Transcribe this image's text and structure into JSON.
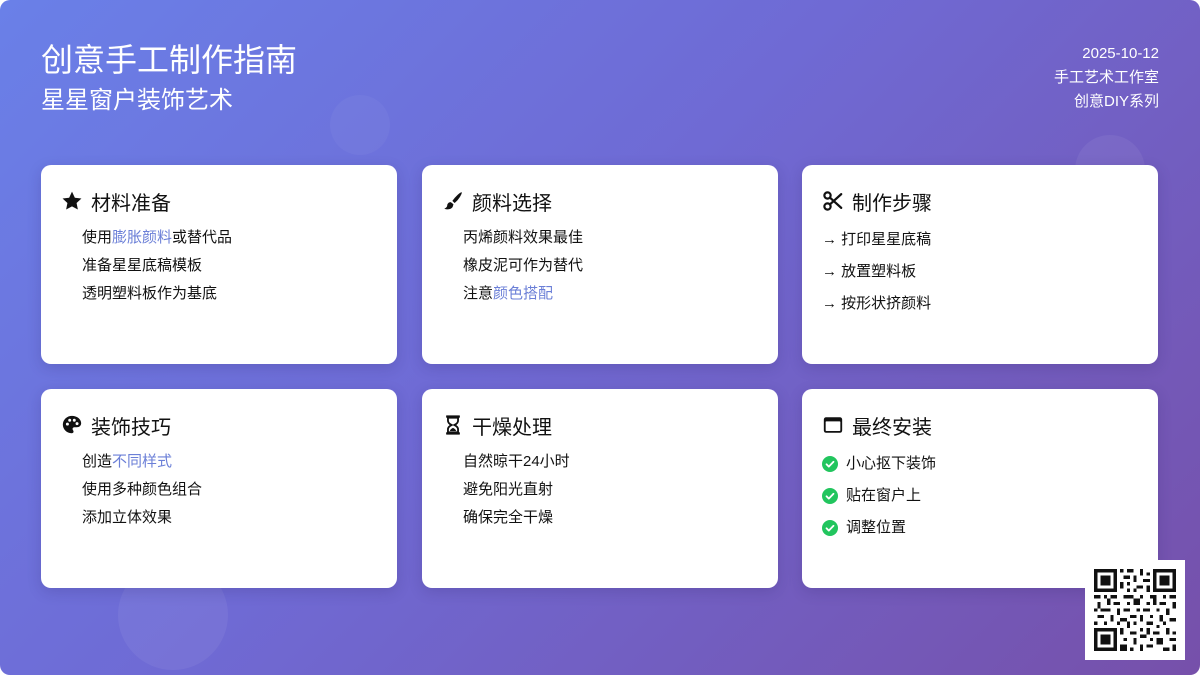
{
  "header": {
    "title": "创意手工制作指南",
    "subtitle": "星星窗户装饰艺术",
    "date": "2025-10-12",
    "studio": "手工艺术工作室",
    "series": "创意DIY系列"
  },
  "colors": {
    "highlight": "#6b7fd7",
    "check": "#22c55e",
    "gradient_start": "#6a80e8",
    "gradient_end": "#7650aa"
  },
  "cards": [
    {
      "title": "材料准备",
      "icon": "star-icon",
      "items": [
        {
          "pre": "使用",
          "hl": "膨胀颜料",
          "post": "或替代品"
        },
        {
          "pre": "准备星星底稿模板",
          "hl": "",
          "post": ""
        },
        {
          "pre": "透明塑料板作为基底",
          "hl": "",
          "post": ""
        }
      ]
    },
    {
      "title": "颜料选择",
      "icon": "paintbrush-icon",
      "items": [
        {
          "pre": "丙烯颜料效果最佳",
          "hl": "",
          "post": ""
        },
        {
          "pre": "橡皮泥可作为替代",
          "hl": "",
          "post": ""
        },
        {
          "pre": "注意",
          "hl": "颜色搭配",
          "post": ""
        }
      ]
    },
    {
      "title": "制作步骤",
      "icon": "scissors-icon",
      "items": [
        {
          "pre": "→ 打印星星底稿"
        },
        {
          "pre": "→ 放置塑料板"
        },
        {
          "pre": "→ 按形状挤颜料"
        }
      ]
    },
    {
      "title": "装饰技巧",
      "icon": "palette-icon",
      "items": [
        {
          "pre": "创造",
          "hl": "不同样式",
          "post": ""
        },
        {
          "pre": "使用多种颜色组合",
          "hl": "",
          "post": ""
        },
        {
          "pre": "添加立体效果",
          "hl": "",
          "post": ""
        }
      ]
    },
    {
      "title": "干燥处理",
      "icon": "hourglass-icon",
      "items": [
        {
          "pre": "自然晾干24小时",
          "hl": "",
          "post": ""
        },
        {
          "pre": "避免阳光直射",
          "hl": "",
          "post": ""
        },
        {
          "pre": "确保完全干燥",
          "hl": "",
          "post": ""
        }
      ]
    },
    {
      "title": "最终安装",
      "icon": "window-icon",
      "items": [
        {
          "pre": "小心抠下装饰"
        },
        {
          "pre": "贴在窗户上"
        },
        {
          "pre": "调整位置"
        }
      ]
    }
  ]
}
